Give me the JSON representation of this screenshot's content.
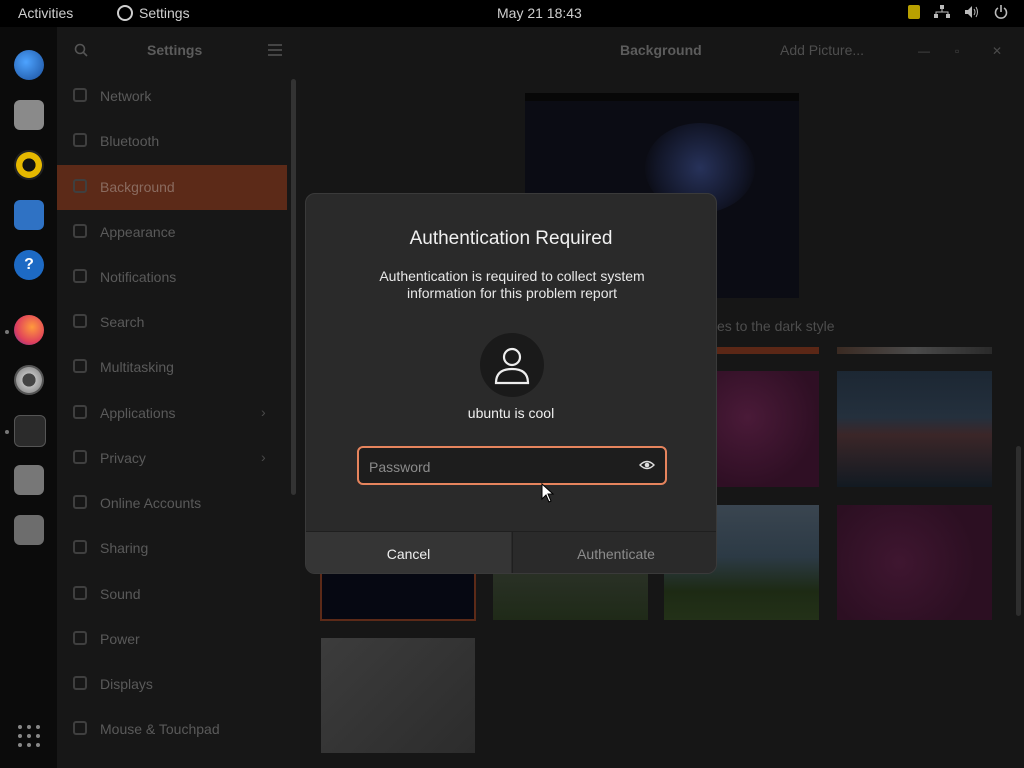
{
  "topbar": {
    "activities": "Activities",
    "app_name": "Settings",
    "clock": "May 21  18:43",
    "tray_icons": [
      "clipboard-indicator-icon",
      "network-icon",
      "volume-icon",
      "power-icon"
    ]
  },
  "dock": {
    "apps": [
      "thunderbird-icon",
      "files-icon",
      "rhythmbox-icon",
      "writer-icon",
      "help-icon",
      "firefox-icon",
      "settings-icon",
      "terminal-icon",
      "save-disk-icon",
      "trash-icon",
      "show-apps-icon"
    ]
  },
  "settings": {
    "sidebar_title": "Settings",
    "items": [
      {
        "label": "Network",
        "icon": "network-icon"
      },
      {
        "label": "Bluetooth",
        "icon": "bluetooth-icon"
      },
      {
        "label": "Background",
        "icon": "background-icon",
        "active": true
      },
      {
        "label": "Appearance",
        "icon": "appearance-icon"
      },
      {
        "label": "Notifications",
        "icon": "bell-icon"
      },
      {
        "label": "Search",
        "icon": "search-icon"
      },
      {
        "label": "Multitasking",
        "icon": "multitasking-icon"
      },
      {
        "label": "Applications",
        "icon": "apps-icon",
        "chevron": true
      },
      {
        "label": "Privacy",
        "icon": "lock-icon",
        "chevron": true
      },
      {
        "label": "Online Accounts",
        "icon": "cloud-icon"
      },
      {
        "label": "Sharing",
        "icon": "share-icon"
      },
      {
        "label": "Sound",
        "icon": "music-note-icon"
      },
      {
        "label": "Power",
        "icon": "power-icon"
      },
      {
        "label": "Displays",
        "icon": "display-icon"
      },
      {
        "label": "Mouse & Touchpad",
        "icon": "mouse-icon"
      }
    ],
    "page_title": "Background",
    "add_picture": "Add Picture...",
    "dark_style_note": "es to the dark style"
  },
  "dialog": {
    "title": "Authentication Required",
    "message": "Authentication is required to collect system information for this problem report",
    "username": "ubuntu is cool",
    "password_placeholder": "Password",
    "cancel": "Cancel",
    "authenticate": "Authenticate",
    "accent": "#e6845d"
  }
}
